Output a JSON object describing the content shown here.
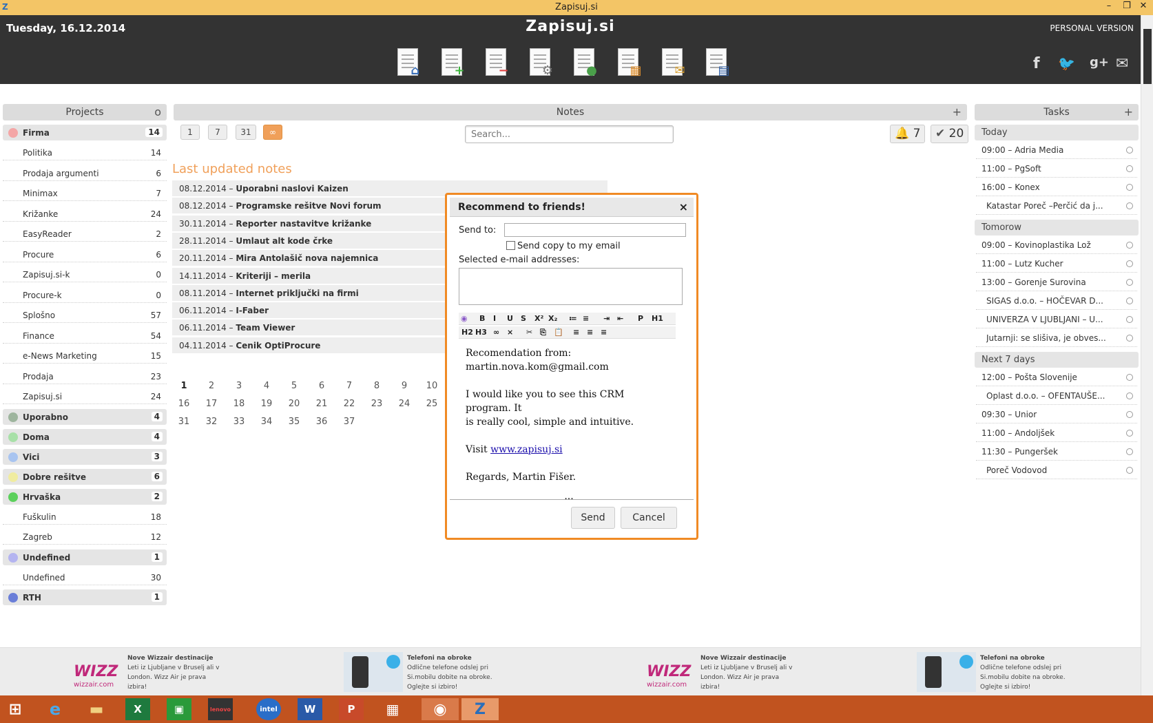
{
  "window": {
    "title": "Zapisuj.si"
  },
  "header": {
    "date": "Tuesday, 16.12.2014",
    "logo": "Zapisuj.si",
    "version": "PERSONAL VERSION"
  },
  "projects": {
    "title": "Projects",
    "corner": "o",
    "items": [
      {
        "name": "Firma",
        "count": "14",
        "group": true,
        "color": "#f4a6a6"
      },
      {
        "name": "Politika",
        "count": "14"
      },
      {
        "name": "Prodaja argumenti",
        "count": "6"
      },
      {
        "name": "Minimax",
        "count": "7"
      },
      {
        "name": "Križanke",
        "count": "24"
      },
      {
        "name": "EasyReader",
        "count": "2"
      },
      {
        "name": "Procure",
        "count": "6"
      },
      {
        "name": "Zapisuj.si-k",
        "count": "0"
      },
      {
        "name": "Procure-k",
        "count": "0"
      },
      {
        "name": "Splošno",
        "count": "57"
      },
      {
        "name": "Finance",
        "count": "54"
      },
      {
        "name": "e-News Marketing",
        "count": "15"
      },
      {
        "name": "Prodaja",
        "count": "23"
      },
      {
        "name": "Zapisuj.si",
        "count": "24"
      },
      {
        "name": "Uporabno",
        "count": "4",
        "group": true,
        "color": "#9eb59e"
      },
      {
        "name": "Doma",
        "count": "4",
        "group": true,
        "color": "#a8e0a8"
      },
      {
        "name": "Vici",
        "count": "3",
        "group": true,
        "color": "#a8c4f0"
      },
      {
        "name": "Dobre rešitve",
        "count": "6",
        "group": true,
        "color": "#f0eca0"
      },
      {
        "name": "Hrvaška",
        "count": "2",
        "group": true,
        "color": "#5cd05c"
      },
      {
        "name": "Fuškulin",
        "count": "18"
      },
      {
        "name": "Zagreb",
        "count": "12"
      },
      {
        "name": "Undefined",
        "count": "1",
        "group": true,
        "color": "#b4b4f0"
      },
      {
        "name": "Undefined",
        "count": "30"
      },
      {
        "name": "RTH",
        "count": "1",
        "group": true,
        "color": "#6a7ed8"
      }
    ]
  },
  "notes": {
    "title": "Notes",
    "add": "+",
    "filters": [
      "1",
      "7",
      "31",
      "∞"
    ],
    "search_placeholder": "Search...",
    "reminders": "7",
    "done": "20",
    "section_title": "Last updated notes",
    "items": [
      {
        "date": "08.12.2014",
        "title": "Uporabni naslovi Kaizen"
      },
      {
        "date": "08.12.2014",
        "title": "Programske rešitve Novi forum"
      },
      {
        "date": "30.11.2014",
        "title": "Reporter nastavitve križanke"
      },
      {
        "date": "28.11.2014",
        "title": "Umlaut alt kode črke"
      },
      {
        "date": "20.11.2014",
        "title": "Mira Antolašič nova najemnica"
      },
      {
        "date": "14.11.2014",
        "title": "Kriteriji – merila"
      },
      {
        "date": "08.11.2014",
        "title": "Internet priključki na firmi"
      },
      {
        "date": "06.11.2014",
        "title": "I-Faber"
      },
      {
        "date": "06.11.2014",
        "title": "Team Viewer"
      },
      {
        "date": "04.11.2014",
        "title": "Cenik OptiProcure"
      }
    ],
    "pages": [
      "1",
      "2",
      "3",
      "4",
      "5",
      "6",
      "7",
      "8",
      "9",
      "10",
      "16",
      "17",
      "18",
      "19",
      "20",
      "21",
      "22",
      "23",
      "24",
      "25",
      "31",
      "32",
      "33",
      "34",
      "35",
      "36",
      "37"
    ]
  },
  "tasks": {
    "title": "Tasks",
    "add": "+",
    "groups": [
      {
        "label": "Today",
        "items": [
          "09:00 – Adria Media",
          "11:00 – PgSoft",
          "16:00 – Konex",
          "Katastar Poreč –Perčić da j..."
        ]
      },
      {
        "label": "Tomorow",
        "items": [
          "09:00 – Kovinoplastika Lož",
          "11:00 – Lutz Kucher",
          "13:00 – Gorenje Surovina",
          "SIGAS d.o.o. – HOČEVAR D...",
          "UNIVERZA V LJUBLJANI – U...",
          "Jutarnji: se slišiva, je obves..."
        ]
      },
      {
        "label": "Next 7 days",
        "items": [
          "12:00 – Pošta Slovenije",
          "Oplast d.o.o. – OFENTAUŠE...",
          "09:30 – Unior",
          "11:00 – Andoljšek",
          "11:30 – Pungeršek",
          "Poreč Vodovod"
        ]
      }
    ]
  },
  "dialog": {
    "title": "Recommend to friends!",
    "close": "×",
    "send_to_label": "Send to:",
    "send_to_value": "",
    "copy_label": "Send copy to my email",
    "selected_label": "Selected e-mail addresses:",
    "toolbar1": [
      "B",
      "I",
      "U",
      "S",
      "X²",
      "X₂",
      "≔",
      "≡",
      "⇥",
      "⇤",
      "P",
      "H1"
    ],
    "toolbar2": [
      "H2",
      "H3",
      "∞",
      "⨯",
      "✂",
      "⎘",
      "📋",
      "≡",
      "≡",
      "≡"
    ],
    "body": {
      "line1": "Recomendation from:",
      "line2": "martin.nova.kom@gmail.com",
      "line3": "I would like you to see this CRM program. It",
      "line4": "is really cool, simple and intuitive.",
      "visit": "Visit",
      "link": "www.zapisuj.si",
      "regards": "Regards, Martin Fišer.",
      "more": "..."
    },
    "send": "Send",
    "cancel": "Cancel"
  },
  "ads": [
    {
      "logo": "wizz",
      "logo_sub": "wizzair.com",
      "title": "Nove Wizzair destinacije",
      "text": "Leti iz Ljubljane v Bruselj ali v London. Wizz Air je prava izbira!"
    },
    {
      "logo": "phone",
      "title": "Telefoni na obroke",
      "text": "Odlične telefone odslej pri Si.mobilu dobite na obroke. Oglejte si izbiro!"
    },
    {
      "logo": "wizz",
      "logo_sub": "wizzair.com",
      "title": "Nove Wizzair destinacije",
      "text": "Leti iz Ljubljane v Bruselj ali v London. Wizz Air je prava izbira!"
    },
    {
      "logo": "phone",
      "title": "Telefoni na obroke",
      "text": "Odlične telefone odslej pri Si.mobilu dobite na obroke. Oglejte si izbiro!"
    }
  ],
  "colors": {
    "accent": "#f0a05a",
    "header": "#333333",
    "taskbar": "#c1531f",
    "dialog_border": "#f08a24"
  }
}
